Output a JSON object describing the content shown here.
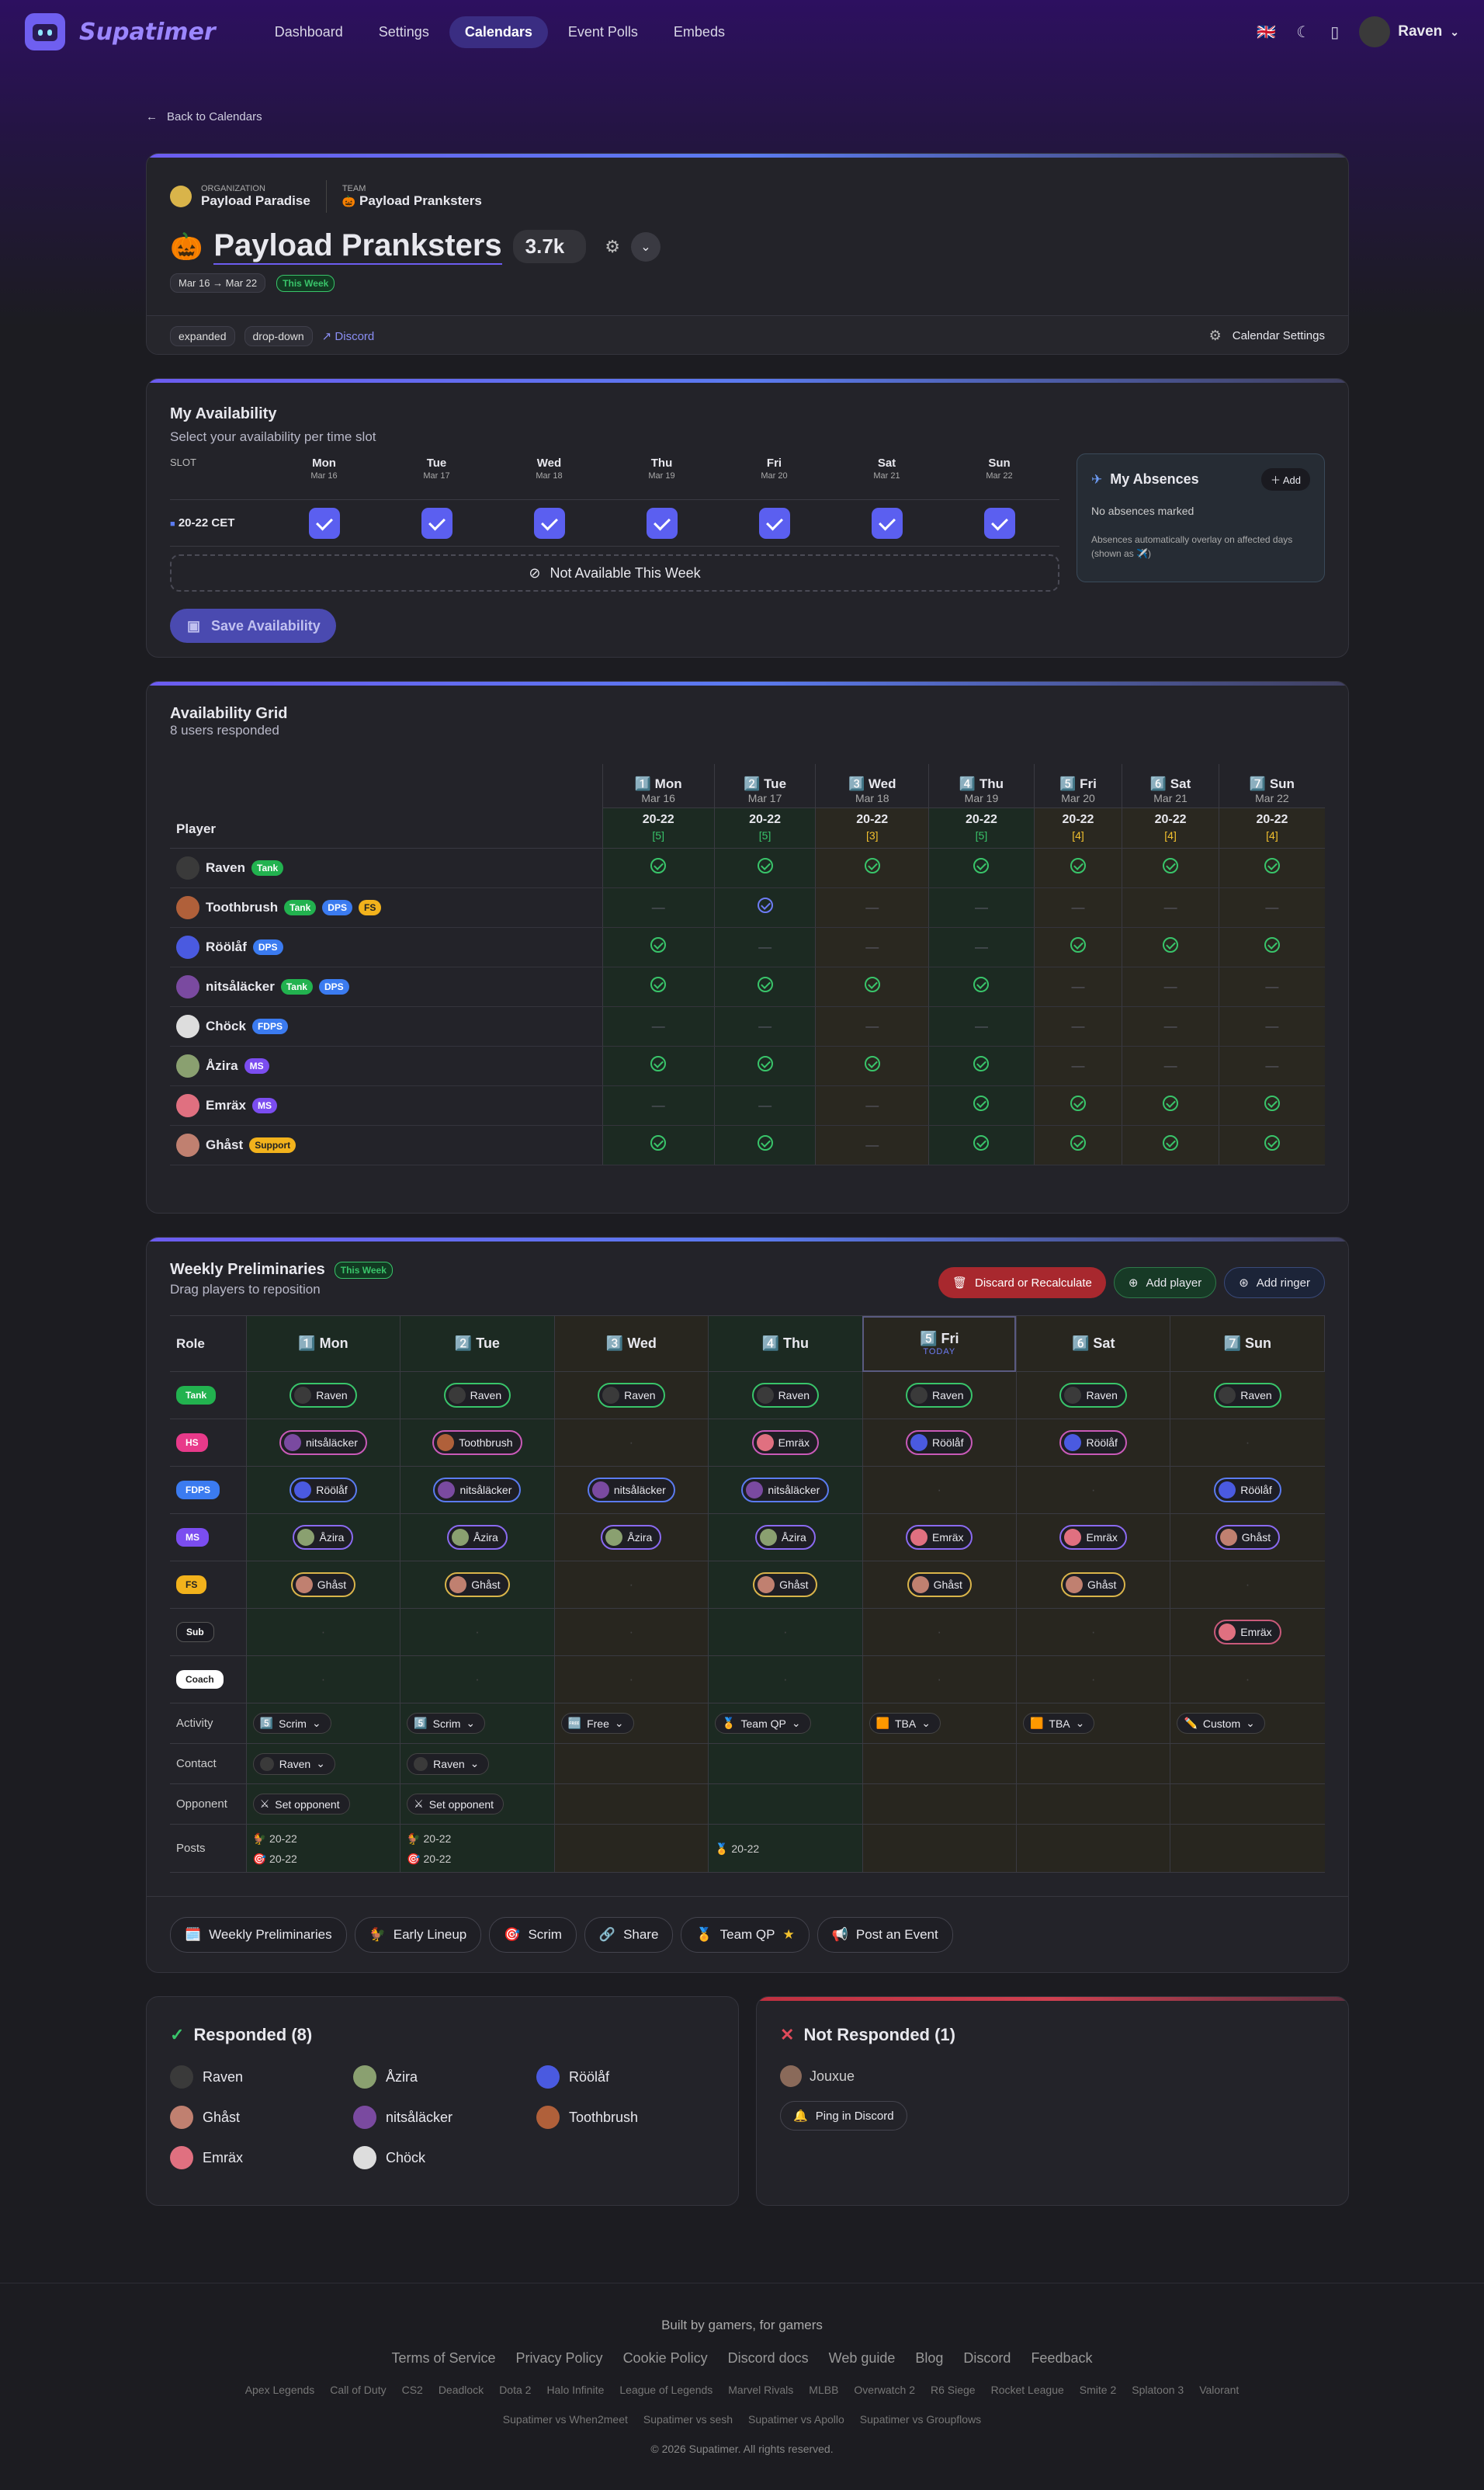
{
  "nav": {
    "brand": "Supatimer",
    "links": [
      "Dashboard",
      "Settings",
      "Calendars",
      "Event Polls",
      "Embeds"
    ],
    "active": 2,
    "flag": "🇬🇧",
    "user": "Raven"
  },
  "back": "Back to Calendars",
  "header": {
    "org_label": "ORGANIZATION",
    "org": "Payload Paradise",
    "team_label": "TEAM",
    "team": "Payload Pranksters",
    "title": "Payload Pranksters",
    "emoji": "🎃",
    "sr": "3.7k",
    "range": "Mar 16 → Mar 22",
    "this_week": "This Week",
    "chips": [
      "expanded",
      "drop-down"
    ],
    "discord": "Discord",
    "settings": "Calendar Settings"
  },
  "myavail": {
    "title": "My Availability",
    "subtitle": "Select your availability per time slot",
    "slot_label": "SLOT",
    "slot": "20-22 CET",
    "days": [
      {
        "d": "Mon",
        "date": "Mar 16"
      },
      {
        "d": "Tue",
        "date": "Mar 17"
      },
      {
        "d": "Wed",
        "date": "Mar 18"
      },
      {
        "d": "Thu",
        "date": "Mar 19"
      },
      {
        "d": "Fri",
        "date": "Mar 20"
      },
      {
        "d": "Sat",
        "date": "Mar 21"
      },
      {
        "d": "Sun",
        "date": "Mar 22"
      }
    ],
    "not_available": "Not Available This Week",
    "save": "Save Availability",
    "absences": {
      "title": "My Absences",
      "add": "Add",
      "none": "No absences marked",
      "note": "Absences automatically overlay on affected days (shown as ✈️)"
    }
  },
  "grid": {
    "title": "Availability Grid",
    "subtitle": "8 users responded",
    "player_label": "Player",
    "cols": [
      {
        "n": "1️⃣",
        "d": "Mon",
        "date": "Mar 16",
        "slot": "20-22",
        "count": "[5]",
        "c": "g"
      },
      {
        "n": "2️⃣",
        "d": "Tue",
        "date": "Mar 17",
        "slot": "20-22",
        "count": "[5]",
        "c": "g"
      },
      {
        "n": "3️⃣",
        "d": "Wed",
        "date": "Mar 18",
        "slot": "20-22",
        "count": "[3]",
        "c": "y"
      },
      {
        "n": "4️⃣",
        "d": "Thu",
        "date": "Mar 19",
        "slot": "20-22",
        "count": "[5]",
        "c": "g"
      },
      {
        "n": "5️⃣",
        "d": "Fri",
        "date": "Mar 20",
        "slot": "20-22",
        "count": "[4]",
        "c": "y"
      },
      {
        "n": "6️⃣",
        "d": "Sat",
        "date": "Mar 21",
        "slot": "20-22",
        "count": "[4]",
        "c": "y"
      },
      {
        "n": "7️⃣",
        "d": "Sun",
        "date": "Mar 22",
        "slot": "20-22",
        "count": "[4]",
        "c": "y"
      }
    ],
    "rows": [
      {
        "name": "Raven",
        "tags": [
          [
            "Tank",
            "tank"
          ]
        ],
        "v": [
          1,
          1,
          1,
          1,
          1,
          1,
          1
        ],
        "av": "#3a3a3a"
      },
      {
        "name": "Toothbrush",
        "tags": [
          [
            "Tank",
            "tank"
          ],
          [
            "DPS",
            "dps"
          ],
          [
            "FS",
            "fs"
          ]
        ],
        "v": [
          0,
          2,
          0,
          0,
          0,
          0,
          0
        ],
        "av": "#b0603a"
      },
      {
        "name": "Röölåf",
        "tags": [
          [
            "DPS",
            "dps"
          ]
        ],
        "v": [
          1,
          0,
          0,
          0,
          1,
          1,
          1
        ],
        "av": "#4a5ae0"
      },
      {
        "name": "nitsåläcker",
        "tags": [
          [
            "Tank",
            "tank"
          ],
          [
            "DPS",
            "dps"
          ]
        ],
        "v": [
          1,
          1,
          1,
          1,
          0,
          0,
          0
        ],
        "av": "#7a4aa0"
      },
      {
        "name": "Chöck",
        "tags": [
          [
            "FDPS",
            "fdps"
          ]
        ],
        "v": [
          0,
          0,
          0,
          0,
          0,
          0,
          0
        ],
        "av": "#dddddd"
      },
      {
        "name": "Åzira",
        "tags": [
          [
            "MS",
            "ms"
          ]
        ],
        "v": [
          1,
          1,
          1,
          1,
          0,
          0,
          0
        ],
        "av": "#8aa070"
      },
      {
        "name": "Emräx",
        "tags": [
          [
            "MS",
            "ms"
          ]
        ],
        "v": [
          0,
          0,
          0,
          1,
          1,
          1,
          1
        ],
        "av": "#e07080"
      },
      {
        "name": "Ghåst",
        "tags": [
          [
            "Support",
            "support"
          ]
        ],
        "v": [
          1,
          1,
          0,
          1,
          1,
          1,
          1
        ],
        "av": "#c08070"
      }
    ]
  },
  "prelim": {
    "title": "Weekly Preliminaries",
    "this_week": "This Week",
    "subtitle": "Drag players to reposition",
    "discard": "Discard or Recalculate",
    "add_player": "Add player",
    "add_ringer": "Add ringer",
    "role_label": "Role",
    "today": "TODAY",
    "days": [
      {
        "n": "1️⃣",
        "d": "Mon",
        "c": "g"
      },
      {
        "n": "2️⃣",
        "d": "Tue",
        "c": "g"
      },
      {
        "n": "3️⃣",
        "d": "Wed",
        "c": "y"
      },
      {
        "n": "4️⃣",
        "d": "Thu",
        "c": "g"
      },
      {
        "n": "5️⃣",
        "d": "Fri",
        "c": "y",
        "today": true
      },
      {
        "n": "6️⃣",
        "d": "Sat",
        "c": "y"
      },
      {
        "n": "7️⃣",
        "d": "Sun",
        "c": "y"
      }
    ],
    "roles": [
      {
        "r": "Tank",
        "k": "tank",
        "cells": [
          "Raven",
          "Raven",
          "Raven",
          "Raven",
          "Raven",
          "Raven",
          "Raven"
        ]
      },
      {
        "r": "HS",
        "k": "hs",
        "cells": [
          "nitsåläcker",
          "Toothbrush",
          "",
          "Emräx",
          "Röölåf",
          "Röölåf",
          ""
        ]
      },
      {
        "r": "FDPS",
        "k": "fdps",
        "cells": [
          "Röölåf",
          "nitsåläcker",
          "nitsåläcker",
          "nitsåläcker",
          "",
          "",
          "Röölåf"
        ]
      },
      {
        "r": "MS",
        "k": "ms",
        "cells": [
          "Åzira",
          "Åzira",
          "Åzira",
          "Åzira",
          "Emräx",
          "Emräx",
          "Ghåst"
        ]
      },
      {
        "r": "FS",
        "k": "fs",
        "cells": [
          "Ghåst",
          "Ghåst",
          "",
          "Ghåst",
          "Ghåst",
          "Ghåst",
          ""
        ]
      },
      {
        "r": "Sub",
        "k": "sub",
        "cells": [
          "",
          "",
          "",
          "",
          "",
          "",
          "Emräx"
        ]
      },
      {
        "r": "Coach",
        "k": "coach",
        "cells": [
          "",
          "",
          "",
          "",
          "",
          "",
          ""
        ]
      }
    ],
    "activity_label": "Activity",
    "contact_label": "Contact",
    "opponent_label": "Opponent",
    "posts_label": "Posts",
    "activity": [
      [
        "5️⃣",
        "Scrim"
      ],
      [
        "5️⃣",
        "Scrim"
      ],
      [
        "🆓",
        "Free"
      ],
      [
        "🏅",
        "Team QP"
      ],
      [
        "🟧",
        "TBA"
      ],
      [
        "🟧",
        "TBA"
      ],
      [
        "✏️",
        "Custom"
      ]
    ],
    "contact": [
      "Raven",
      "Raven",
      "",
      "",
      "",
      "",
      ""
    ],
    "opponent": [
      "Set opponent",
      "Set opponent",
      "",
      "",
      "",
      "",
      ""
    ],
    "posts": [
      [
        "🐓 20-22",
        "🎯 20-22"
      ],
      [
        "🐓 20-22",
        "🎯 20-22"
      ],
      [],
      [
        "🏅 20-22"
      ],
      [],
      [],
      []
    ],
    "actions": [
      [
        "🗓️",
        "Weekly Preliminaries"
      ],
      [
        "🐓",
        "Early Lineup"
      ],
      [
        "🎯",
        "Scrim"
      ],
      [
        "🔗",
        "Share"
      ],
      [
        "🏅",
        "Team QP"
      ],
      [
        "📢",
        "Post an Event"
      ]
    ]
  },
  "responded": {
    "title": "Responded (8)",
    "users": [
      "Raven",
      "Åzira",
      "Röölåf",
      "Ghåst",
      "nitsåläcker",
      "Toothbrush",
      "Emräx",
      "Chöck"
    ]
  },
  "notresp": {
    "title": "Not Responded (1)",
    "users": [
      "Jouxue"
    ],
    "ping": "Ping in Discord"
  },
  "footer": {
    "tag": "Built by gamers, for gamers",
    "links": [
      "Terms of Service",
      "Privacy Policy",
      "Cookie Policy",
      "Discord docs",
      "Web guide",
      "Blog",
      "Discord",
      "Feedback"
    ],
    "games": [
      "Apex Legends",
      "Call of Duty",
      "CS2",
      "Deadlock",
      "Dota 2",
      "Halo Infinite",
      "League of Legends",
      "Marvel Rivals",
      "MLBB",
      "Overwatch 2",
      "R6 Siege",
      "Rocket League",
      "Smite 2",
      "Splatoon 3",
      "Valorant"
    ],
    "vs": [
      "Supatimer vs When2meet",
      "Supatimer vs sesh",
      "Supatimer vs Apollo",
      "Supatimer vs Groupflows"
    ],
    "copy": "© 2026 Supatimer. All rights reserved."
  },
  "colors": {
    "accent": "#5b5ff0",
    "green": "#39c46a",
    "yellow": "#f2c12e",
    "danger": "#d33a4a"
  }
}
